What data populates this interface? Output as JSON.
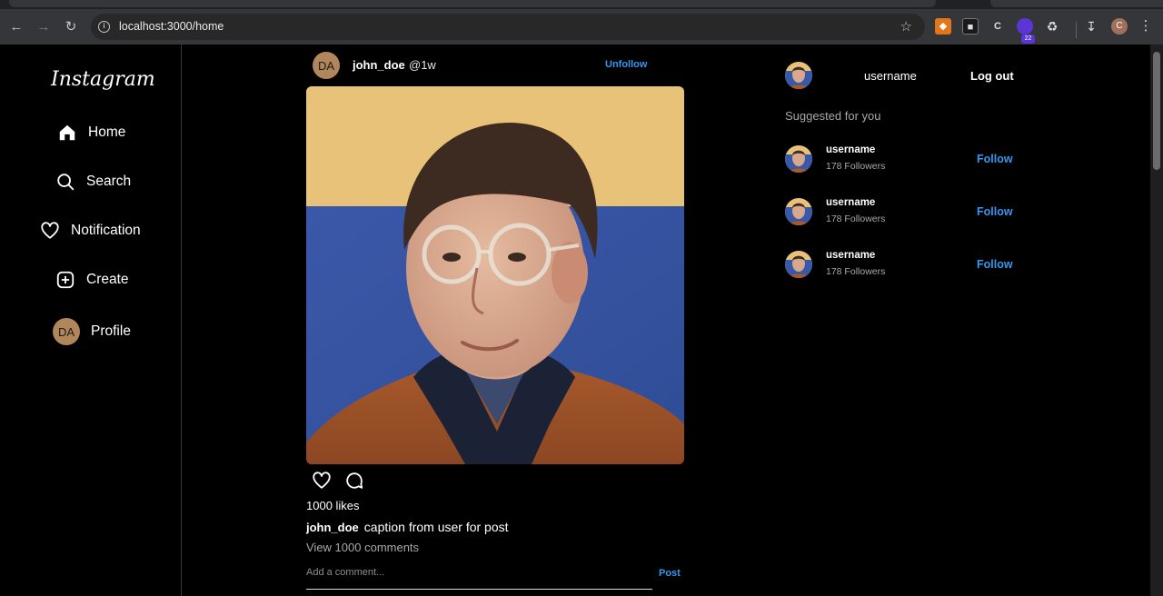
{
  "browser": {
    "url": "localhost:3000/home",
    "extension_badge": "22",
    "profile_initial": "C",
    "icons": [
      "back-icon",
      "forward-icon",
      "reload-icon",
      "site-info-icon",
      "bookmark-star-icon",
      "extensions-icon",
      "download-icon",
      "menu-icon"
    ]
  },
  "sidebar": {
    "logo": "Instagram",
    "items": [
      {
        "label": "Home",
        "icon": "home-icon"
      },
      {
        "label": "Search",
        "icon": "search-icon"
      },
      {
        "label": "Notification",
        "icon": "heart-icon"
      },
      {
        "label": "Create",
        "icon": "plus-square-icon"
      },
      {
        "label": "Profile",
        "icon": "avatar",
        "avatar_text": "DA"
      }
    ]
  },
  "post": {
    "avatar_text": "DA",
    "username": "john_doe",
    "time": "@1w",
    "unfollow_label": "Unfollow",
    "likes": "1000 likes",
    "caption_user": "john_doe",
    "caption": "caption from user for post",
    "view_comments": "View 1000 comments",
    "comment_placeholder": "Add a comment...",
    "post_label": "Post"
  },
  "right_panel": {
    "username": "username",
    "logout_label": "Log out",
    "suggested_title": "Suggested for you",
    "suggestions": [
      {
        "name": "username",
        "followers": "178 Followers",
        "action": "Follow"
      },
      {
        "name": "username",
        "followers": "178 Followers",
        "action": "Follow"
      },
      {
        "name": "username",
        "followers": "178 Followers",
        "action": "Follow"
      }
    ]
  },
  "colors": {
    "background": "#000000",
    "accent": "#3897f0",
    "avatar_bg": "#b0865a"
  }
}
